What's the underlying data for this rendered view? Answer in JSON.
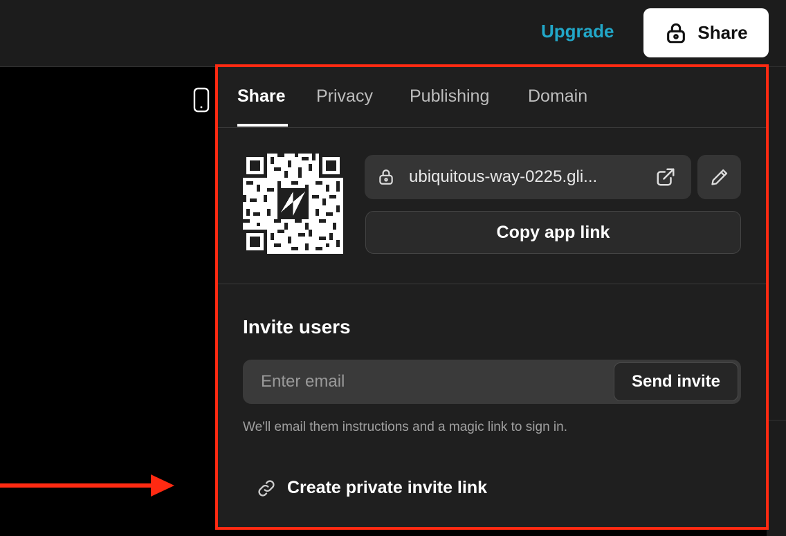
{
  "header": {
    "upgrade_label": "Upgrade",
    "share_label": "Share"
  },
  "panel": {
    "tabs": [
      {
        "label": "Share",
        "active": true
      },
      {
        "label": "Privacy",
        "active": false
      },
      {
        "label": "Publishing",
        "active": false
      },
      {
        "label": "Domain",
        "active": false
      }
    ],
    "app_url": "ubiquitous-way-0225.gli...",
    "copy_label": "Copy app link",
    "invite": {
      "title": "Invite users",
      "email_placeholder": "Enter email",
      "send_label": "Send invite",
      "hint": "We'll email them instructions and a magic link to sign in.",
      "private_link_label": "Create private invite link"
    }
  },
  "colors": {
    "accent": "#22a7c8",
    "highlight_border": "#ff2a12",
    "panel_bg": "#1f1f1f"
  },
  "icons": [
    "lock-icon",
    "phone-icon",
    "qr-code",
    "external-link-icon",
    "pencil-icon",
    "link-icon",
    "arrow-pointer"
  ]
}
